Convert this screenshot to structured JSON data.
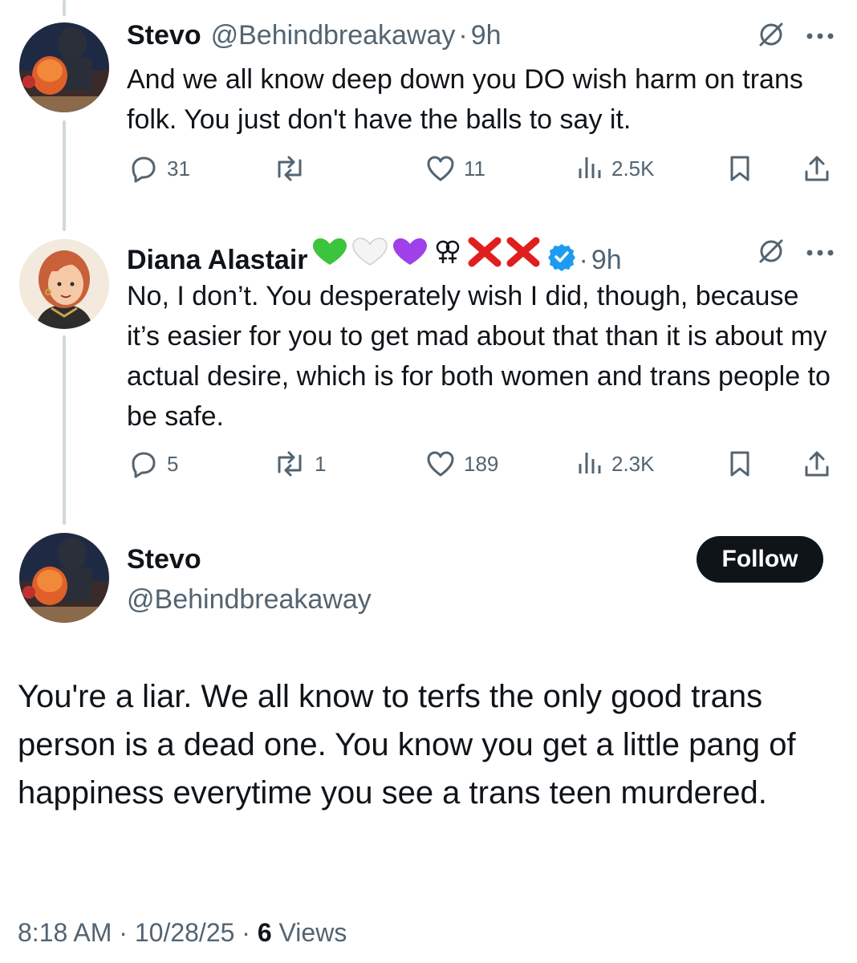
{
  "replies": [
    {
      "name": "Stevo",
      "handle": "@Behindbreakaway",
      "separator": "·",
      "time": "9h",
      "text": "And we all know deep down you DO wish harm on trans folk. You just don't have the balls to say it.",
      "stats": {
        "replies": "31",
        "reposts": "",
        "likes": "11",
        "views": "2.5K"
      }
    },
    {
      "name": "Diana Alastair",
      "name_emojis": "💚🤍💜⚢❌❌",
      "verified": true,
      "separator": "·",
      "time": "9h",
      "text": "No, I don’t. You desperately wish I did, though, because it’s easier for you to get mad about that than it is about my actual desire, which is for both women and trans people to be safe.",
      "stats": {
        "replies": "5",
        "reposts": "1",
        "likes": "189",
        "views": "2.3K"
      }
    }
  ],
  "main_tweet": {
    "name": "Stevo",
    "handle": "@Behindbreakaway",
    "follow_label": "Follow",
    "text": "You're a liar. We all know to terfs the only good trans person is a dead one. You know you get a little pang of happiness everytime you see a trans teen murdered.",
    "time": "8:18 AM",
    "date": "10/28/25",
    "separator": "·",
    "views_count": "6",
    "views_label": "Views"
  },
  "colors": {
    "text": "#0f1419",
    "secondary": "#536471",
    "verified": "#1d9bf0",
    "thread_line": "#cfd9de"
  },
  "icons": [
    "reply-icon",
    "repost-icon",
    "like-icon",
    "views-icon",
    "bookmark-icon",
    "share-icon",
    "grok-icon",
    "more-icon",
    "verified-badge-icon"
  ]
}
